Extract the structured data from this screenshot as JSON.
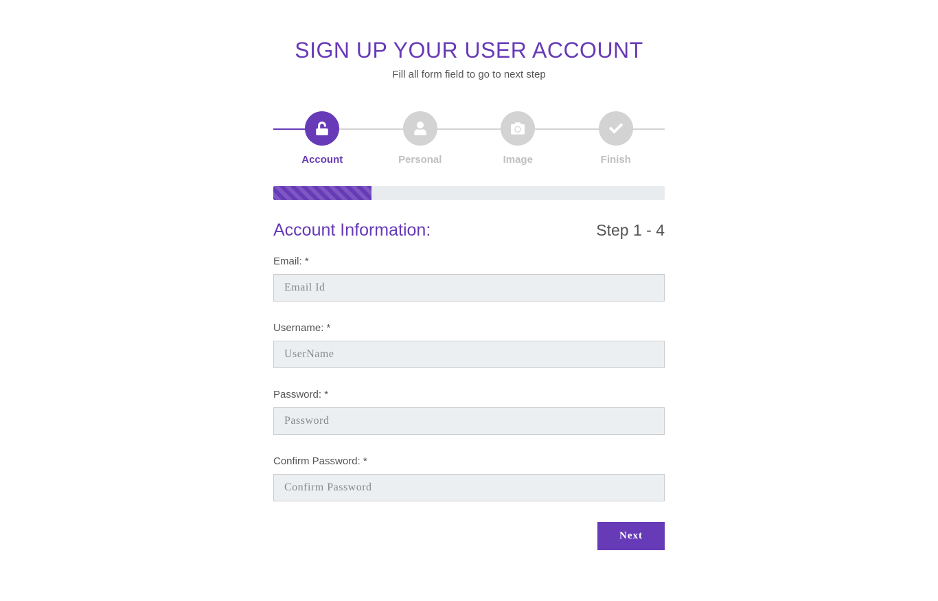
{
  "header": {
    "title": "SIGN UP YOUR USER ACCOUNT",
    "subtitle": "Fill all form field to go to next step"
  },
  "steps": [
    {
      "label": "Account",
      "icon": "lock-open",
      "active": true
    },
    {
      "label": "Personal",
      "icon": "user",
      "active": false
    },
    {
      "label": "Image",
      "icon": "camera",
      "active": false
    },
    {
      "label": "Finish",
      "icon": "check",
      "active": false
    }
  ],
  "progress_percent": 25,
  "form": {
    "title": "Account Information:",
    "step_text": "Step 1 - 4",
    "fields": {
      "email": {
        "label": "Email: *",
        "placeholder": "Email Id",
        "value": ""
      },
      "username": {
        "label": "Username: *",
        "placeholder": "UserName",
        "value": ""
      },
      "password": {
        "label": "Password: *",
        "placeholder": "Password",
        "value": ""
      },
      "confirm_password": {
        "label": "Confirm Password: *",
        "placeholder": "Confirm Password",
        "value": ""
      }
    },
    "next_button": "Next"
  },
  "colors": {
    "primary": "#673ab7",
    "inactive": "#d3d3d3",
    "input_bg": "#eceff1"
  }
}
